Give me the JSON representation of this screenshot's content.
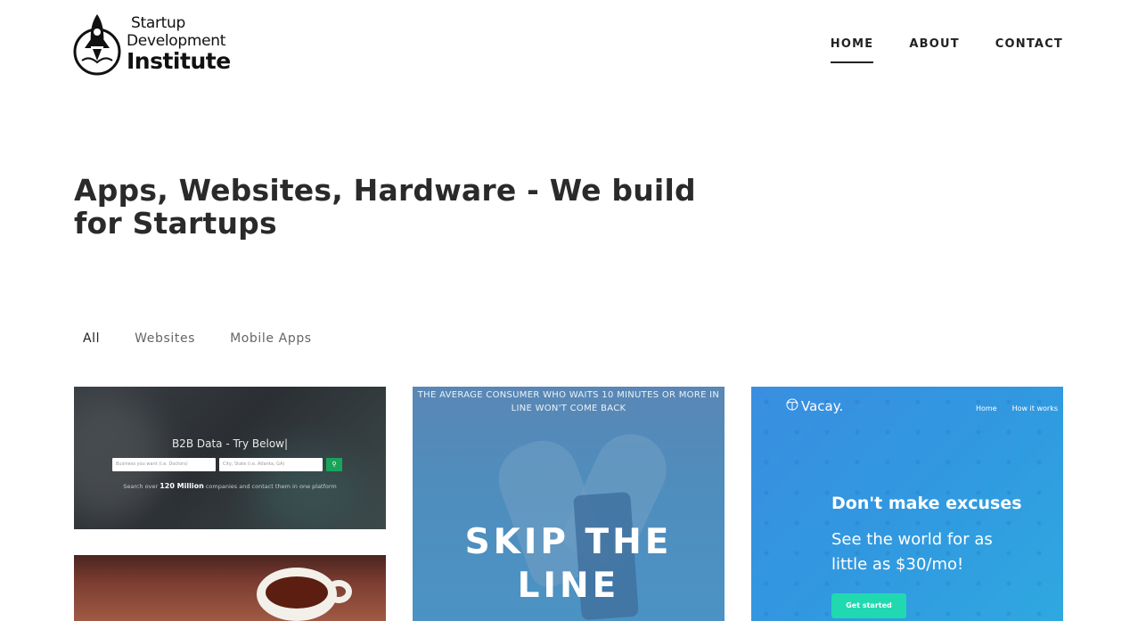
{
  "logo": {
    "line1": "Startup",
    "line2": "Development",
    "line3": "Institute",
    "icon": "rocket-icon"
  },
  "nav": {
    "items": [
      {
        "label": "HOME",
        "active": true
      },
      {
        "label": "ABOUT",
        "active": false
      },
      {
        "label": "CONTACT",
        "active": false
      }
    ]
  },
  "hero": {
    "title": "Apps, Websites, Hardware - We build for Startups"
  },
  "filters": {
    "items": [
      {
        "label": "All",
        "active": true
      },
      {
        "label": "Websites",
        "active": false
      },
      {
        "label": "Mobile Apps",
        "active": false
      }
    ]
  },
  "portfolio": {
    "card1": {
      "title": "B2B Data - Try Below|",
      "input1_placeholder": "Business you want (i.e. Doctors)",
      "input2_placeholder": "City, State (i.e. Atlanta, GA)",
      "sub_prefix": "Search over ",
      "sub_bold": "120 Million",
      "sub_suffix": " companies and contact them in one platform",
      "button_icon": "search-icon"
    },
    "card2": {
      "top_text": "THE AVERAGE CONSUMER WHO WAITS 10 MINUTES OR MORE IN LINE WON'T COME BACK",
      "big_line1": "SKIP THE",
      "big_line2": "LINE"
    },
    "card3": {
      "logo": "Vacay.",
      "nav_home": "Home",
      "nav_how": "How it works",
      "headline": "Don't make excuses",
      "subhead": "See the world for as little as $30/mo!",
      "button": "Get started"
    }
  },
  "colors": {
    "accent_green": "#1aa35a",
    "vacay_blue": "#3198e0",
    "vacay_button": "#21d9b0",
    "text_dark": "#222222"
  }
}
